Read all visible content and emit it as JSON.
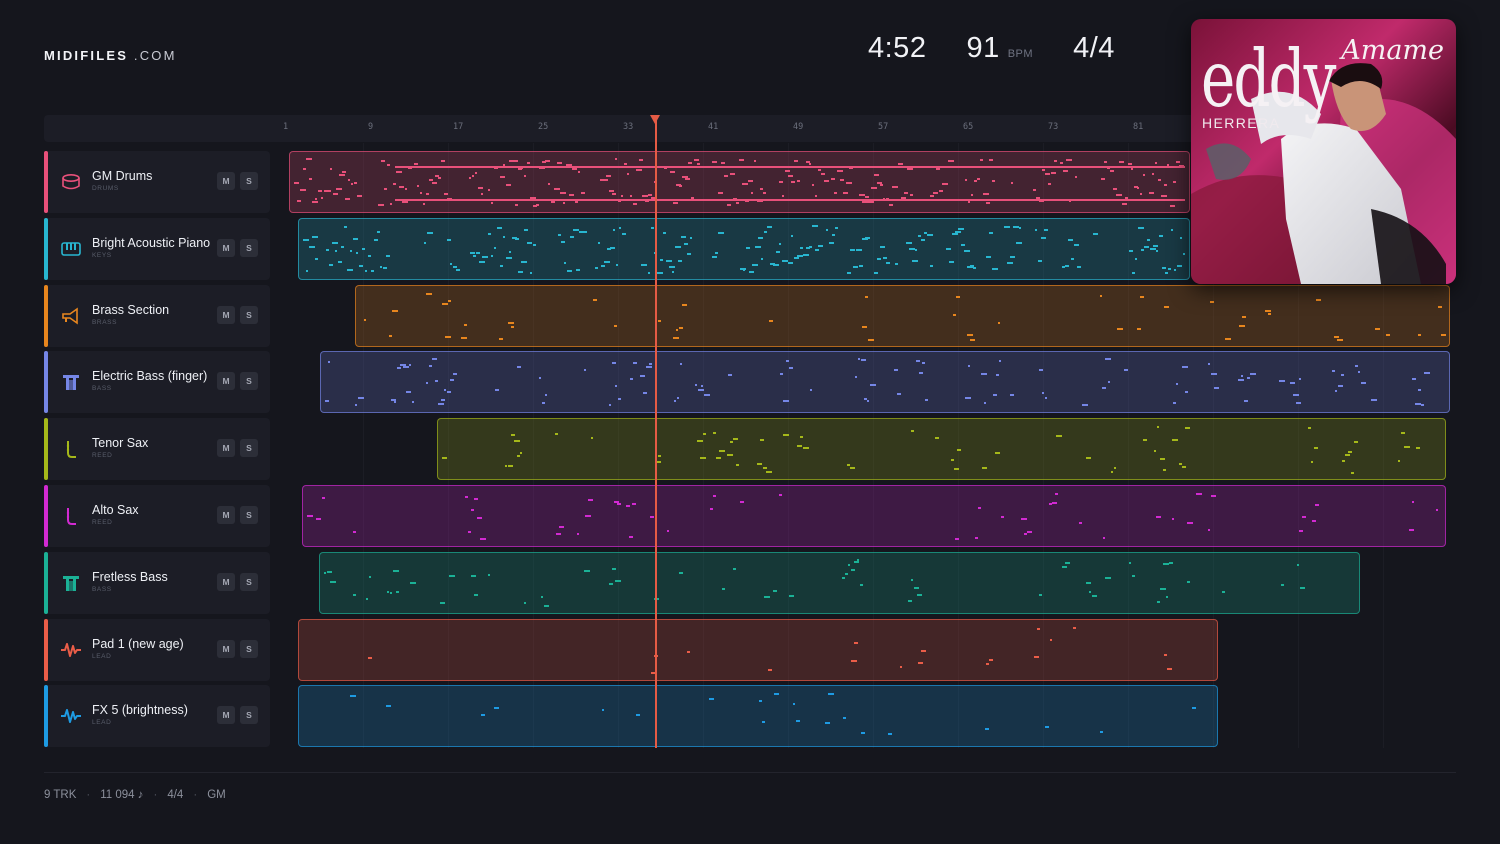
{
  "brand": {
    "name": "MIDIFILES",
    "suffix": ".COM"
  },
  "transport": {
    "duration": "4:52",
    "tempo": "91",
    "tempo_unit": "BPM",
    "time_signature": "4/4"
  },
  "album": {
    "artist_first": "eddy",
    "artist_last": "HERRERA",
    "title": "Amame"
  },
  "ruler": {
    "ticks": [
      "1",
      "9",
      "17",
      "25",
      "33",
      "41",
      "49",
      "57",
      "65",
      "73",
      "81"
    ],
    "playhead_bar": 36
  },
  "buttons": {
    "mute": "M",
    "solo": "S"
  },
  "tracks": [
    {
      "name": "GM Drums",
      "category": "DRUMS",
      "color": "#e8507a",
      "icon": "drum-icon"
    },
    {
      "name": "Bright Acoustic Piano",
      "category": "KEYS",
      "color": "#28b6d0",
      "icon": "piano-icon"
    },
    {
      "name": "Brass Section",
      "category": "BRASS",
      "color": "#e8861e",
      "icon": "trumpet-icon"
    },
    {
      "name": "Electric Bass (finger)",
      "category": "BASS",
      "color": "#7586e6",
      "icon": "bass-icon"
    },
    {
      "name": "Tenor Sax",
      "category": "REED",
      "color": "#a5b81a",
      "icon": "sax-icon"
    },
    {
      "name": "Alto Sax",
      "category": "REED",
      "color": "#d22ad2",
      "icon": "sax-icon"
    },
    {
      "name": "Fretless Bass",
      "category": "BASS",
      "color": "#1bb196",
      "icon": "bass-icon"
    },
    {
      "name": "Pad 1 (new age)",
      "category": "LEAD",
      "color": "#ea5d48",
      "icon": "wave-icon"
    },
    {
      "name": "FX 5 (brightness)",
      "category": "LEAD",
      "color": "#1e9be3",
      "icon": "wave-icon"
    }
  ],
  "footer": {
    "tracks": "9 TRK",
    "notes": "11 094 ♪",
    "meter": "4/4",
    "standard": "GM"
  }
}
